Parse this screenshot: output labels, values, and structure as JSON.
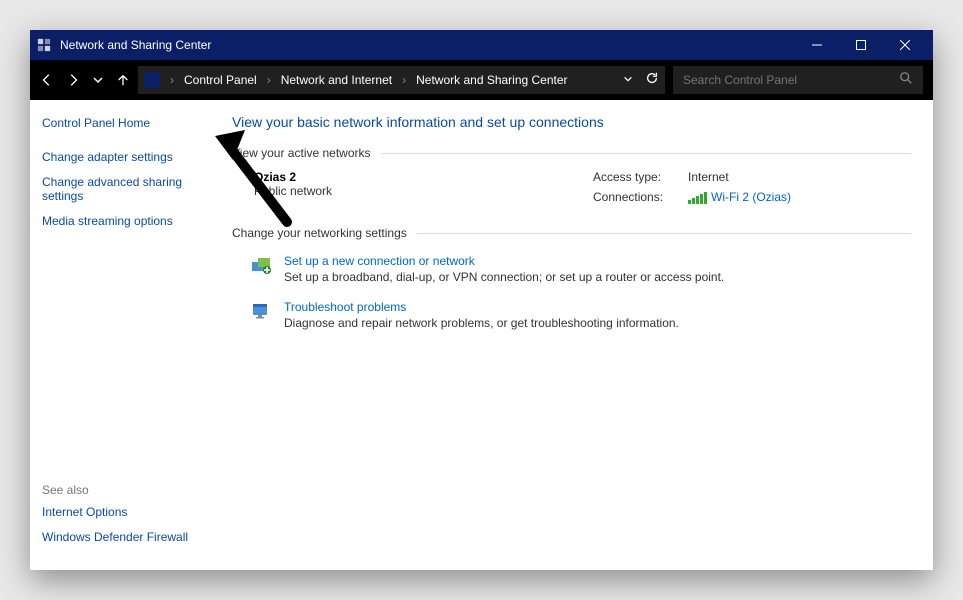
{
  "window": {
    "title": "Network and Sharing Center"
  },
  "breadcrumb": {
    "root": "Control Panel",
    "mid": "Network and Internet",
    "leaf": "Network and Sharing Center"
  },
  "search": {
    "placeholder": "Search Control Panel"
  },
  "sidebar": {
    "home": "Control Panel Home",
    "links": [
      "Change adapter settings",
      "Change advanced sharing settings",
      "Media streaming options"
    ],
    "seealso_header": "See also",
    "seealso": [
      "Internet Options",
      "Windows Defender Firewall"
    ]
  },
  "main": {
    "heading": "View your basic network information and set up connections",
    "active_networks_label": "View your active networks",
    "network": {
      "name": "Ozias 2",
      "type": "Public network",
      "access_label": "Access type:",
      "access_value": "Internet",
      "conn_label": "Connections:",
      "conn_value": "Wi-Fi 2 (Ozias)"
    },
    "change_label": "Change your networking settings",
    "actions": [
      {
        "title": "Set up a new connection or network",
        "desc": "Set up a broadband, dial-up, or VPN connection; or set up a router or access point."
      },
      {
        "title": "Troubleshoot problems",
        "desc": "Diagnose and repair network problems, or get troubleshooting information."
      }
    ]
  }
}
